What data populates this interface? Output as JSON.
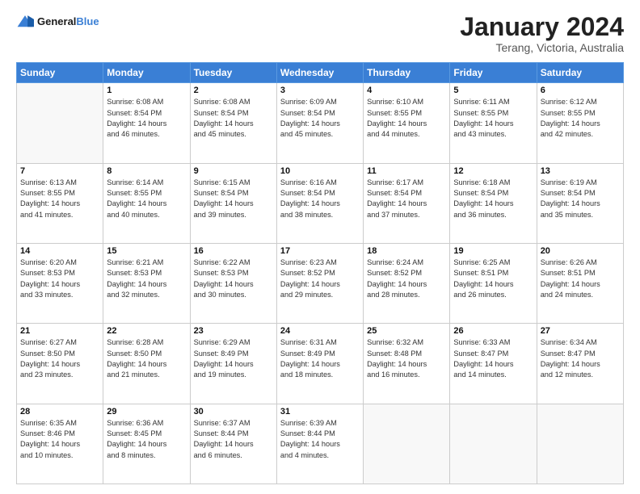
{
  "header": {
    "logo_line1": "General",
    "logo_line2": "Blue",
    "month_title": "January 2024",
    "location": "Terang, Victoria, Australia"
  },
  "weekdays": [
    "Sunday",
    "Monday",
    "Tuesday",
    "Wednesday",
    "Thursday",
    "Friday",
    "Saturday"
  ],
  "weeks": [
    [
      {
        "day": "",
        "sunrise": "",
        "sunset": "",
        "daylight": ""
      },
      {
        "day": "1",
        "sunrise": "Sunrise: 6:08 AM",
        "sunset": "Sunset: 8:54 PM",
        "daylight": "Daylight: 14 hours and 46 minutes."
      },
      {
        "day": "2",
        "sunrise": "Sunrise: 6:08 AM",
        "sunset": "Sunset: 8:54 PM",
        "daylight": "Daylight: 14 hours and 45 minutes."
      },
      {
        "day": "3",
        "sunrise": "Sunrise: 6:09 AM",
        "sunset": "Sunset: 8:54 PM",
        "daylight": "Daylight: 14 hours and 45 minutes."
      },
      {
        "day": "4",
        "sunrise": "Sunrise: 6:10 AM",
        "sunset": "Sunset: 8:55 PM",
        "daylight": "Daylight: 14 hours and 44 minutes."
      },
      {
        "day": "5",
        "sunrise": "Sunrise: 6:11 AM",
        "sunset": "Sunset: 8:55 PM",
        "daylight": "Daylight: 14 hours and 43 minutes."
      },
      {
        "day": "6",
        "sunrise": "Sunrise: 6:12 AM",
        "sunset": "Sunset: 8:55 PM",
        "daylight": "Daylight: 14 hours and 42 minutes."
      }
    ],
    [
      {
        "day": "7",
        "sunrise": "Sunrise: 6:13 AM",
        "sunset": "Sunset: 8:55 PM",
        "daylight": "Daylight: 14 hours and 41 minutes."
      },
      {
        "day": "8",
        "sunrise": "Sunrise: 6:14 AM",
        "sunset": "Sunset: 8:55 PM",
        "daylight": "Daylight: 14 hours and 40 minutes."
      },
      {
        "day": "9",
        "sunrise": "Sunrise: 6:15 AM",
        "sunset": "Sunset: 8:54 PM",
        "daylight": "Daylight: 14 hours and 39 minutes."
      },
      {
        "day": "10",
        "sunrise": "Sunrise: 6:16 AM",
        "sunset": "Sunset: 8:54 PM",
        "daylight": "Daylight: 14 hours and 38 minutes."
      },
      {
        "day": "11",
        "sunrise": "Sunrise: 6:17 AM",
        "sunset": "Sunset: 8:54 PM",
        "daylight": "Daylight: 14 hours and 37 minutes."
      },
      {
        "day": "12",
        "sunrise": "Sunrise: 6:18 AM",
        "sunset": "Sunset: 8:54 PM",
        "daylight": "Daylight: 14 hours and 36 minutes."
      },
      {
        "day": "13",
        "sunrise": "Sunrise: 6:19 AM",
        "sunset": "Sunset: 8:54 PM",
        "daylight": "Daylight: 14 hours and 35 minutes."
      }
    ],
    [
      {
        "day": "14",
        "sunrise": "Sunrise: 6:20 AM",
        "sunset": "Sunset: 8:53 PM",
        "daylight": "Daylight: 14 hours and 33 minutes."
      },
      {
        "day": "15",
        "sunrise": "Sunrise: 6:21 AM",
        "sunset": "Sunset: 8:53 PM",
        "daylight": "Daylight: 14 hours and 32 minutes."
      },
      {
        "day": "16",
        "sunrise": "Sunrise: 6:22 AM",
        "sunset": "Sunset: 8:53 PM",
        "daylight": "Daylight: 14 hours and 30 minutes."
      },
      {
        "day": "17",
        "sunrise": "Sunrise: 6:23 AM",
        "sunset": "Sunset: 8:52 PM",
        "daylight": "Daylight: 14 hours and 29 minutes."
      },
      {
        "day": "18",
        "sunrise": "Sunrise: 6:24 AM",
        "sunset": "Sunset: 8:52 PM",
        "daylight": "Daylight: 14 hours and 28 minutes."
      },
      {
        "day": "19",
        "sunrise": "Sunrise: 6:25 AM",
        "sunset": "Sunset: 8:51 PM",
        "daylight": "Daylight: 14 hours and 26 minutes."
      },
      {
        "day": "20",
        "sunrise": "Sunrise: 6:26 AM",
        "sunset": "Sunset: 8:51 PM",
        "daylight": "Daylight: 14 hours and 24 minutes."
      }
    ],
    [
      {
        "day": "21",
        "sunrise": "Sunrise: 6:27 AM",
        "sunset": "Sunset: 8:50 PM",
        "daylight": "Daylight: 14 hours and 23 minutes."
      },
      {
        "day": "22",
        "sunrise": "Sunrise: 6:28 AM",
        "sunset": "Sunset: 8:50 PM",
        "daylight": "Daylight: 14 hours and 21 minutes."
      },
      {
        "day": "23",
        "sunrise": "Sunrise: 6:29 AM",
        "sunset": "Sunset: 8:49 PM",
        "daylight": "Daylight: 14 hours and 19 minutes."
      },
      {
        "day": "24",
        "sunrise": "Sunrise: 6:31 AM",
        "sunset": "Sunset: 8:49 PM",
        "daylight": "Daylight: 14 hours and 18 minutes."
      },
      {
        "day": "25",
        "sunrise": "Sunrise: 6:32 AM",
        "sunset": "Sunset: 8:48 PM",
        "daylight": "Daylight: 14 hours and 16 minutes."
      },
      {
        "day": "26",
        "sunrise": "Sunrise: 6:33 AM",
        "sunset": "Sunset: 8:47 PM",
        "daylight": "Daylight: 14 hours and 14 minutes."
      },
      {
        "day": "27",
        "sunrise": "Sunrise: 6:34 AM",
        "sunset": "Sunset: 8:47 PM",
        "daylight": "Daylight: 14 hours and 12 minutes."
      }
    ],
    [
      {
        "day": "28",
        "sunrise": "Sunrise: 6:35 AM",
        "sunset": "Sunset: 8:46 PM",
        "daylight": "Daylight: 14 hours and 10 minutes."
      },
      {
        "day": "29",
        "sunrise": "Sunrise: 6:36 AM",
        "sunset": "Sunset: 8:45 PM",
        "daylight": "Daylight: 14 hours and 8 minutes."
      },
      {
        "day": "30",
        "sunrise": "Sunrise: 6:37 AM",
        "sunset": "Sunset: 8:44 PM",
        "daylight": "Daylight: 14 hours and 6 minutes."
      },
      {
        "day": "31",
        "sunrise": "Sunrise: 6:39 AM",
        "sunset": "Sunset: 8:44 PM",
        "daylight": "Daylight: 14 hours and 4 minutes."
      },
      {
        "day": "",
        "sunrise": "",
        "sunset": "",
        "daylight": ""
      },
      {
        "day": "",
        "sunrise": "",
        "sunset": "",
        "daylight": ""
      },
      {
        "day": "",
        "sunrise": "",
        "sunset": "",
        "daylight": ""
      }
    ]
  ]
}
